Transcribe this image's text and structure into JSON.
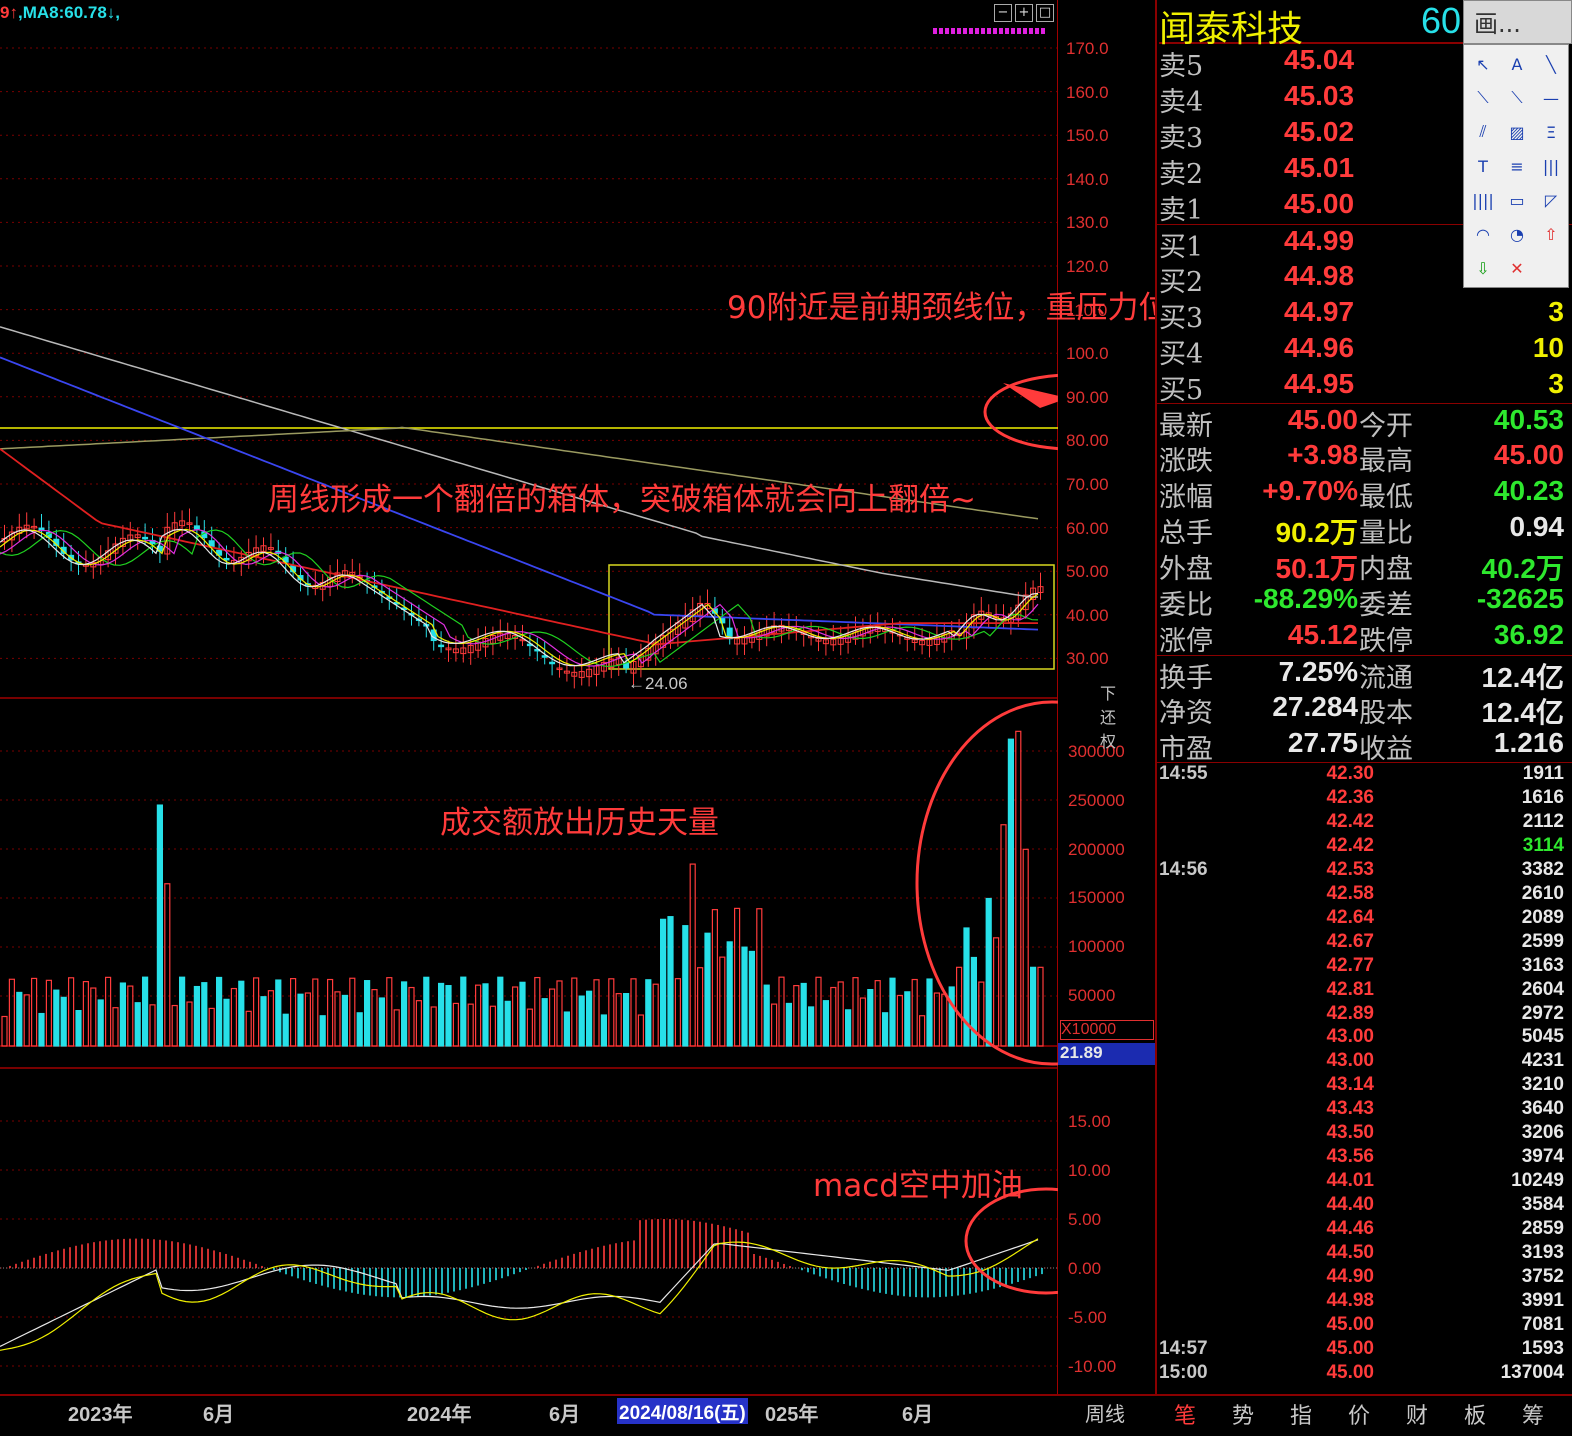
{
  "header": {
    "ma_text_a": "9↑",
    "ma_text_b": ",MA8:60.78↓,",
    "window_buttons": [
      "−",
      "+",
      "□"
    ]
  },
  "price_axis": [
    "170.0",
    "160.0",
    "150.0",
    "140.0",
    "130.0",
    "120.0",
    "110.0",
    "100.0",
    "90.00",
    "80.00",
    "70.00",
    "60.00",
    "50.00",
    "40.00",
    "30.00"
  ],
  "volume_axis": [
    "300000",
    "250000",
    "200000",
    "150000",
    "100000",
    "50000"
  ],
  "volume_unit": "X10000",
  "volume_value": "21.89",
  "macd_axis": [
    "15.00",
    "10.00",
    "5.00",
    "0.00",
    "-5.00",
    "-10.00"
  ],
  "low_marker": "24.06",
  "fq_label": "下还权",
  "time_axis": {
    "labels": [
      "2023年",
      "6月",
      "2024年",
      "6月",
      "025年",
      "6月"
    ],
    "cursor_date": "2024/08/16(五)",
    "period": "周线"
  },
  "annotations": {
    "neckline": "90附近是前期颈线位，重压力位~",
    "box": "周线形成一个翻倍的箱体，突破箱体就会向上翻倍~",
    "volume": "成交额放出历史天量",
    "macd": "macd空中加油"
  },
  "stock": {
    "name": "闻泰科技",
    "code_partial": "60",
    "draw_tool": "画..."
  },
  "order_book": {
    "sells": [
      {
        "label": "卖5",
        "price": "45.04",
        "vol": ""
      },
      {
        "label": "卖4",
        "price": "45.03",
        "vol": ""
      },
      {
        "label": "卖3",
        "price": "45.02",
        "vol": ""
      },
      {
        "label": "卖2",
        "price": "45.01",
        "vol": ""
      },
      {
        "label": "卖1",
        "price": "45.00",
        "vol": ""
      }
    ],
    "buys": [
      {
        "label": "买1",
        "price": "44.99",
        "vol": ""
      },
      {
        "label": "买2",
        "price": "44.98",
        "vol": ""
      },
      {
        "label": "买3",
        "price": "44.97",
        "vol": "3"
      },
      {
        "label": "买4",
        "price": "44.96",
        "vol": "10"
      },
      {
        "label": "买5",
        "price": "44.95",
        "vol": "3"
      }
    ]
  },
  "quote": [
    {
      "l1": "最新",
      "v1": "45.00",
      "l2": "今开",
      "v2": "40.53",
      "c1": "#ff3b3b",
      "c2": "#2ee82e"
    },
    {
      "l1": "涨跌",
      "v1": "+3.98",
      "l2": "最高",
      "v2": "45.00",
      "c1": "#ff3b3b",
      "c2": "#ff3b3b"
    },
    {
      "l1": "涨幅",
      "v1": "+9.70%",
      "l2": "最低",
      "v2": "40.23",
      "c1": "#ff3b3b",
      "c2": "#2ee82e"
    },
    {
      "l1": "总手",
      "v1": "90.2万",
      "l2": "量比",
      "v2": "0.94",
      "c1": "#f0f000",
      "c2": "#e8e8e8"
    },
    {
      "l1": "外盘",
      "v1": "50.1万",
      "l2": "内盘",
      "v2": "40.2万",
      "c1": "#ff3b3b",
      "c2": "#2ee82e"
    },
    {
      "l1": "委比",
      "v1": "-88.29%",
      "l2": "委差",
      "v2": "-32625",
      "c1": "#2ee82e",
      "c2": "#2ee82e"
    },
    {
      "l1": "涨停",
      "v1": "45.12",
      "l2": "跌停",
      "v2": "36.92",
      "c1": "#ff3b3b",
      "c2": "#2ee82e"
    },
    {
      "l1": "换手",
      "v1": "7.25%",
      "l2": "流通",
      "v2": "12.4亿",
      "c1": "#e8e8e8",
      "c2": "#e8e8e8"
    },
    {
      "l1": "净资",
      "v1": "27.284",
      "l2": "股本",
      "v2": "12.4亿",
      "c1": "#e8e8e8",
      "c2": "#e8e8e8"
    },
    {
      "l1": "市盈",
      "v1": "27.75",
      "l2": "收益",
      "v2": "1.216",
      "c1": "#e8e8e8",
      "c2": "#e8e8e8"
    }
  ],
  "ticks": [
    {
      "time": "14:55",
      "price": "42.30",
      "vol": "1911",
      "vc": "#e8e8e8"
    },
    {
      "time": "",
      "price": "42.36",
      "vol": "1616",
      "vc": "#e8e8e8"
    },
    {
      "time": "",
      "price": "42.42",
      "vol": "2112",
      "vc": "#e8e8e8"
    },
    {
      "time": "",
      "price": "42.42",
      "vol": "3114",
      "vc": "#2ee82e"
    },
    {
      "time": "14:56",
      "price": "42.53",
      "vol": "3382",
      "vc": "#e8e8e8"
    },
    {
      "time": "",
      "price": "42.58",
      "vol": "2610",
      "vc": "#e8e8e8"
    },
    {
      "time": "",
      "price": "42.64",
      "vol": "2089",
      "vc": "#e8e8e8"
    },
    {
      "time": "",
      "price": "42.67",
      "vol": "2599",
      "vc": "#e8e8e8"
    },
    {
      "time": "",
      "price": "42.77",
      "vol": "3163",
      "vc": "#e8e8e8"
    },
    {
      "time": "",
      "price": "42.81",
      "vol": "2604",
      "vc": "#e8e8e8"
    },
    {
      "time": "",
      "price": "42.89",
      "vol": "2972",
      "vc": "#e8e8e8"
    },
    {
      "time": "",
      "price": "43.00",
      "vol": "5045",
      "vc": "#e8e8e8"
    },
    {
      "time": "",
      "price": "43.00",
      "vol": "4231",
      "vc": "#e8e8e8"
    },
    {
      "time": "",
      "price": "43.14",
      "vol": "3210",
      "vc": "#e8e8e8"
    },
    {
      "time": "",
      "price": "43.43",
      "vol": "3640",
      "vc": "#e8e8e8"
    },
    {
      "time": "",
      "price": "43.50",
      "vol": "3206",
      "vc": "#e8e8e8"
    },
    {
      "time": "",
      "price": "43.56",
      "vol": "3974",
      "vc": "#e8e8e8"
    },
    {
      "time": "",
      "price": "44.01",
      "vol": "10249",
      "vc": "#e8e8e8"
    },
    {
      "time": "",
      "price": "44.40",
      "vol": "3584",
      "vc": "#e8e8e8"
    },
    {
      "time": "",
      "price": "44.46",
      "vol": "2859",
      "vc": "#e8e8e8"
    },
    {
      "time": "",
      "price": "44.50",
      "vol": "3193",
      "vc": "#e8e8e8"
    },
    {
      "time": "",
      "price": "44.90",
      "vol": "3752",
      "vc": "#e8e8e8"
    },
    {
      "time": "",
      "price": "44.98",
      "vol": "3991",
      "vc": "#e8e8e8"
    },
    {
      "time": "",
      "price": "45.00",
      "vol": "7081",
      "vc": "#e8e8e8"
    },
    {
      "time": "14:57",
      "price": "45.00",
      "vol": "1593",
      "vc": "#e8e8e8"
    },
    {
      "time": "15:00",
      "price": "45.00",
      "vol": "137004",
      "vc": "#e8e8e8"
    }
  ],
  "tabs": [
    "笔",
    "势",
    "指",
    "价",
    "财",
    "板",
    "筹"
  ],
  "tools": [
    {
      "glyph": "↖",
      "name": "pointer-tool-icon"
    },
    {
      "glyph": "A",
      "name": "text-tool-icon"
    },
    {
      "glyph": "╲",
      "name": "line-tool-icon"
    },
    {
      "glyph": "⟍",
      "name": "segment-tool-icon"
    },
    {
      "glyph": "⟍",
      "name": "ray-tool-icon"
    },
    {
      "glyph": "—",
      "name": "hline-tool-icon"
    },
    {
      "glyph": "⫽",
      "name": "parallel-tool-icon"
    },
    {
      "glyph": "▨",
      "name": "channel-tool-icon"
    },
    {
      "glyph": "Ξ",
      "name": "fib-tool-icon"
    },
    {
      "glyph": "T",
      "name": "trend-tool-icon"
    },
    {
      "glyph": "≡",
      "name": "level-tool-icon"
    },
    {
      "glyph": "|||",
      "name": "period-tool-icon"
    },
    {
      "glyph": "||||",
      "name": "cycle-tool-icon"
    },
    {
      "glyph": "▭",
      "name": "rect-tool-icon"
    },
    {
      "glyph": "◸",
      "name": "gann-tool-icon"
    },
    {
      "glyph": "◠",
      "name": "arc-tool-icon"
    },
    {
      "glyph": "◔",
      "name": "fan-tool-icon"
    },
    {
      "glyph": "⇧",
      "name": "up-arrow-tool-icon"
    },
    {
      "glyph": "⇩",
      "name": "down-arrow-tool-icon"
    },
    {
      "glyph": "✕",
      "name": "delete-tool-icon"
    }
  ],
  "colors": {
    "up": "#ff3b3b",
    "down": "#27e0e8",
    "ma_yellow": "#f0f000",
    "grid": "#7a0000",
    "box": "#d8d820",
    "annot": "#ff3b3b"
  }
}
